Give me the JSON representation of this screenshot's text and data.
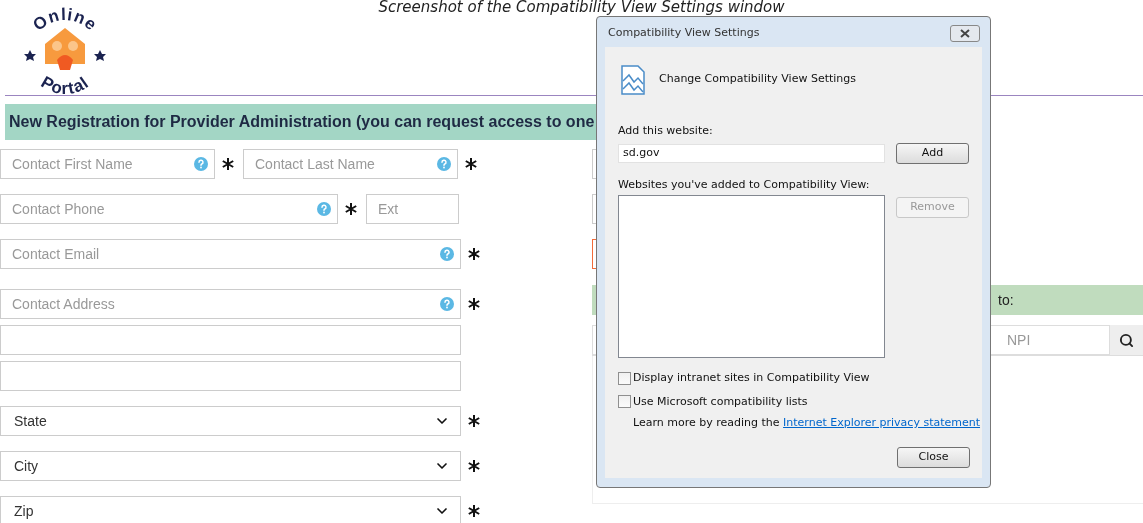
{
  "caption": "Screenshot of the Compatibility View Settings window",
  "logo": {
    "top": "Online",
    "bottom": "Portal"
  },
  "banner": "New Registration for Provider Administration (you can request access to one",
  "form_rows": [
    {
      "fields": [
        {
          "kind": "text",
          "placeholder": "Contact First Name",
          "help": true,
          "required": true
        },
        {
          "kind": "text",
          "placeholder": "Contact Last Name",
          "help": true,
          "required": true
        }
      ]
    },
    {
      "fields": [
        {
          "kind": "text",
          "placeholder": "Contact Phone",
          "help": true,
          "required": true
        },
        {
          "kind": "text",
          "placeholder": "Ext",
          "help": false,
          "required": false
        }
      ]
    },
    {
      "fields": [
        {
          "kind": "text",
          "placeholder": "Contact Email",
          "help": true,
          "required": true
        }
      ]
    },
    {
      "fields": [
        {
          "kind": "text",
          "placeholder": "Contact Address",
          "help": true,
          "required": true
        }
      ]
    },
    {
      "fields": [
        {
          "kind": "text",
          "help": false,
          "required": false
        }
      ]
    },
    {
      "fields": [
        {
          "kind": "text",
          "help": false,
          "required": false
        }
      ]
    },
    {
      "fields": [
        {
          "kind": "select",
          "value": "State",
          "required": true
        }
      ]
    },
    {
      "fields": [
        {
          "kind": "select",
          "value": "City",
          "required": true
        }
      ]
    },
    {
      "fields": [
        {
          "kind": "select",
          "value": "Zip",
          "required": true
        }
      ]
    }
  ],
  "right_panel": {
    "section_header": "to:",
    "search": {
      "placeholder": "NPI"
    }
  },
  "dialog": {
    "title": "Compatibility View Settings",
    "heading": "Change Compatibility View Settings",
    "add_label": "Add this website:",
    "add_value": "sd.gov",
    "add_button": "Add",
    "list_label": "Websites you've added to Compatibility View:",
    "remove_button": {
      "label": "Remove",
      "disabled": true
    },
    "options": [
      {
        "label": "Display intranet sites in Compatibility View",
        "checked": false
      },
      {
        "label": "Use Microsoft compatibility lists",
        "checked": false
      }
    ],
    "learn_more": "Learn more by reading the",
    "link": "Internet Explorer privacy statement",
    "close_button": "Close"
  }
}
